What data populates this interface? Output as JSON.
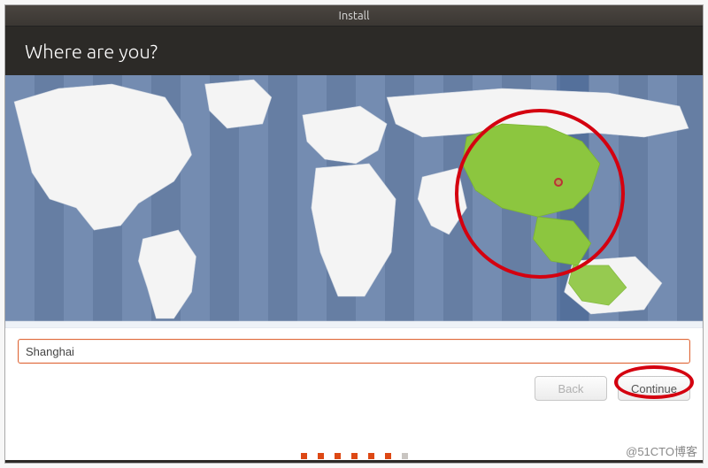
{
  "window": {
    "title": "Install"
  },
  "header": {
    "title": "Where are you?"
  },
  "timezone": {
    "value": "Shanghai",
    "placeholder": ""
  },
  "buttons": {
    "back": "Back",
    "continue": "Continue"
  },
  "progress": {
    "total": 7,
    "current": 6
  },
  "watermark": "@51CTO博客",
  "map": {
    "selected_region": "China",
    "highlight_color": "#8cc63f",
    "marker_city": "Shanghai"
  }
}
